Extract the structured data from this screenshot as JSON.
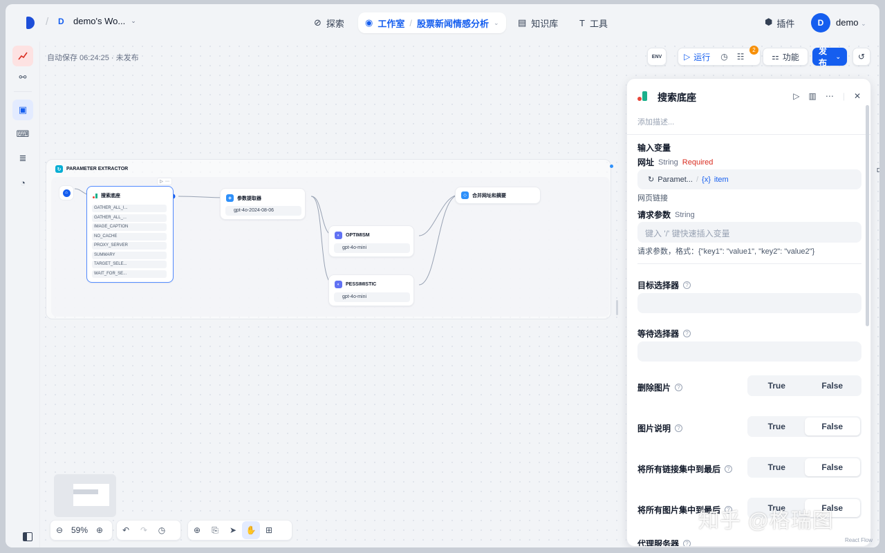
{
  "workspace": {
    "badge": "D",
    "name": "demo's Wo..."
  },
  "nav": {
    "explore": "探索",
    "studio": "工作室",
    "app_name": "股票新闻情感分析",
    "knowledge": "知识库",
    "tools": "工具"
  },
  "top_right": {
    "plugins": "插件",
    "avatar": "D",
    "user": "demo"
  },
  "autosave": "自动保存 06:24:25 · 未发布",
  "toolbar": {
    "env": "ENV",
    "run": "运行",
    "badge_count": "2",
    "features": "功能",
    "publish": "发布"
  },
  "workflow": {
    "group_title": "PARAMETER EXTRACTOR",
    "search_node": {
      "title": "搜索底座",
      "vars": [
        "GATHER_ALL_I...",
        "GATHER_ALL_...",
        "IMAGE_CAPTION",
        "NO_CACHE",
        "PROXY_SERVER",
        "SUMMARY",
        "TARGET_SELE...",
        "WAIT_FOR_SE..."
      ]
    },
    "extractor_node": {
      "title": "参数提取器",
      "model": "gpt-4o-2024-08-06"
    },
    "optimism_node": {
      "title": "OPTIMISM",
      "model": "gpt-4o-mini"
    },
    "pessimistic_node": {
      "title": "PESSIMISTIC",
      "model": "gpt-4o-mini"
    },
    "merge_node": {
      "title": "合并网址和摘要"
    }
  },
  "controls": {
    "zoom": "59%"
  },
  "panel": {
    "title": "搜索底座",
    "description_placeholder": "添加描述...",
    "input_vars_title": "输入变量",
    "url": {
      "label": "网址",
      "type": "String",
      "required": "Required",
      "chip_node": "Paramet...",
      "chip_var": "item",
      "hint": "网页链接"
    },
    "params": {
      "label": "请求参数",
      "type": "String",
      "placeholder": "键入 '/' 键快速插入变量",
      "hint": "请求参数，格式：{\"key1\": \"value1\", \"key2\": \"value2\"}"
    },
    "target_selector": "目标选择器",
    "wait_selector": "等待选择器",
    "remove_images": "删除图片",
    "image_caption": "图片说明",
    "gather_links": "将所有链接集中到最后",
    "gather_images": "将所有图片集中到最后",
    "proxy_server": "代理服务器",
    "true_label": "True",
    "false_label": "False"
  },
  "watermark": "知乎 @格瑞图",
  "footer_brand": "React Flow"
}
